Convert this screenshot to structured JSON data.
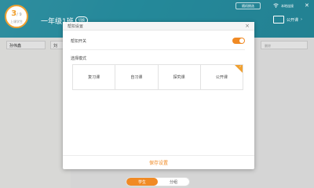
{
  "background": {
    "progress": {
      "current": "3",
      "total": "/ 9",
      "label": "上课学生"
    },
    "class_name": "一年级1班",
    "class_tag": "切换",
    "top_button_a": "随机挑选",
    "top_button_b": "本地连接",
    "screen_label": "公开课",
    "input_1": "孙伟鑫",
    "input_2": "刘",
    "input_3": "删除"
  },
  "modal": {
    "title": "帮扣设置",
    "switch_label": "帮扣开关",
    "switch_on": true,
    "mode_label": "选择模式",
    "modes": [
      "复习课",
      "自习课",
      "探究课",
      "公开课"
    ],
    "selected_mode": "公开课",
    "save_label": "保存设置"
  },
  "bottom_tabs": [
    {
      "label": "学生",
      "active": true
    },
    {
      "label": "分组",
      "active": false
    }
  ],
  "colors": {
    "accent": "#f08a24",
    "header": "#2a9cb0"
  }
}
